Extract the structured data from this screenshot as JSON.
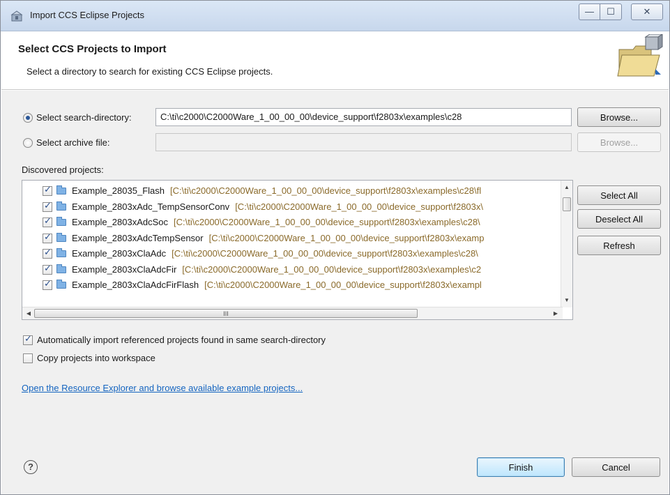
{
  "window": {
    "title": "Import CCS Eclipse Projects",
    "controls": {
      "minimize": "—",
      "maximize": "☐",
      "close": "✕"
    }
  },
  "header": {
    "title": "Select CCS Projects to Import",
    "description": "Select a directory to search for existing CCS Eclipse projects."
  },
  "source": {
    "search_directory_label": "Select search-directory:",
    "search_directory_value": "C:\\ti\\c2000\\C2000Ware_1_00_00_00\\device_support\\f2803x\\examples\\c28",
    "archive_label": "Select archive file:",
    "archive_value": "",
    "browse_label": "Browse...",
    "selected": "search-directory"
  },
  "projects": {
    "label": "Discovered projects:",
    "items": [
      {
        "name": "Example_28035_Flash",
        "path": "[C:\\ti\\c2000\\C2000Ware_1_00_00_00\\device_support\\f2803x\\examples\\c28\\fl",
        "checked": true
      },
      {
        "name": "Example_2803xAdc_TempSensorConv",
        "path": "[C:\\ti\\c2000\\C2000Ware_1_00_00_00\\device_support\\f2803x\\",
        "checked": true
      },
      {
        "name": "Example_2803xAdcSoc",
        "path": "[C:\\ti\\c2000\\C2000Ware_1_00_00_00\\device_support\\f2803x\\examples\\c28\\",
        "checked": true
      },
      {
        "name": "Example_2803xAdcTempSensor",
        "path": "[C:\\ti\\c2000\\C2000Ware_1_00_00_00\\device_support\\f2803x\\examp",
        "checked": true
      },
      {
        "name": "Example_2803xClaAdc",
        "path": "[C:\\ti\\c2000\\C2000Ware_1_00_00_00\\device_support\\f2803x\\examples\\c28\\",
        "checked": true
      },
      {
        "name": "Example_2803xClaAdcFir",
        "path": "[C:\\ti\\c2000\\C2000Ware_1_00_00_00\\device_support\\f2803x\\examples\\c2",
        "checked": true
      },
      {
        "name": "Example_2803xClaAdcFirFlash",
        "path": "[C:\\ti\\c2000\\C2000Ware_1_00_00_00\\device_support\\f2803x\\exampl",
        "checked": true
      }
    ],
    "select_all_label": "Select All",
    "deselect_all_label": "Deselect All",
    "refresh_label": "Refresh",
    "hscroll_grip": "III"
  },
  "options": {
    "auto_import_label": "Automatically import referenced projects found in same search-directory",
    "auto_import_checked": true,
    "copy_label": "Copy projects into workspace",
    "copy_checked": false
  },
  "link": {
    "resource_explorer": "Open the Resource Explorer and browse available example projects..."
  },
  "footer": {
    "help_glyph": "?",
    "finish_label": "Finish",
    "cancel_label": "Cancel"
  }
}
